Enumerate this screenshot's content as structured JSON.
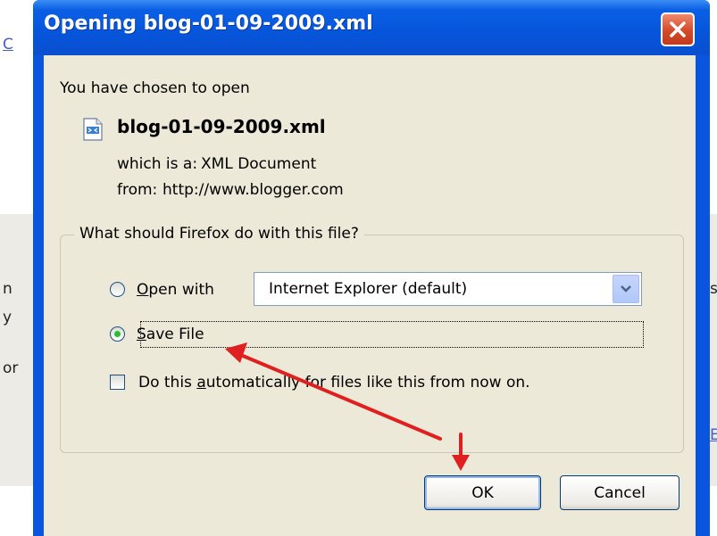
{
  "window": {
    "title": "Opening blog-01-09-2009.xml"
  },
  "dialog": {
    "intro": "You have chosen to open",
    "filename": "blog-01-09-2009.xml",
    "which_is_label": "which is a:",
    "which_is_value": "XML Document",
    "from_label": "from:",
    "from_value": "http://www.blogger.com",
    "group_legend": "What should Firefox do with this file?",
    "open_with": {
      "prefix_underlined": "O",
      "rest": "pen with",
      "selected": false
    },
    "open_with_select": {
      "value": "Internet Explorer (default)"
    },
    "save_file": {
      "prefix_underlined": "S",
      "rest": "ave File",
      "selected": true
    },
    "auto_checkbox": {
      "before": "Do this ",
      "underlined": "a",
      "after": "utomatically for files like this from now on.",
      "checked": false
    },
    "ok_label": "OK",
    "cancel_label": "Cancel"
  },
  "background": {
    "fragments": [
      "C",
      "n",
      "y",
      "or",
      "s",
      "E"
    ]
  },
  "colors": {
    "titlebar": "#0655db",
    "client": "#ece9d8",
    "close_button": "#d24a2a",
    "annotation_arrows": "#e02020"
  },
  "icons": {
    "close": "close-x-icon",
    "file": "xml-file-icon",
    "dropdown": "chevron-down-icon"
  }
}
